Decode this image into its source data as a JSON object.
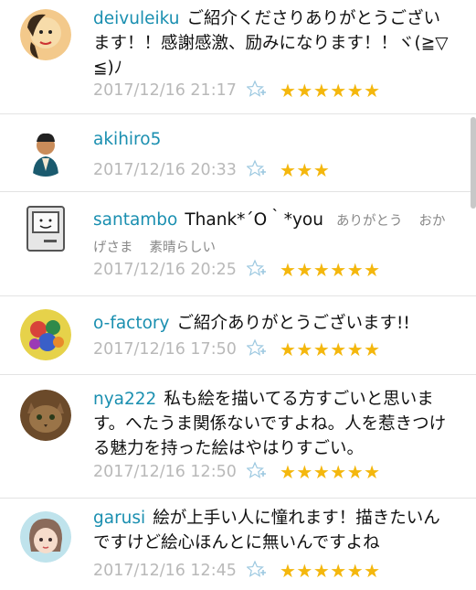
{
  "comments": [
    {
      "user": "deivuleiku",
      "text": "ご紹介くださりありがとうございます！！感謝感激、励みになります！！ヾ(≧▽≦)ﾉ",
      "tags": [],
      "timestamp": "2017/12/16 21:17",
      "stars": "★★★★★★",
      "star_count": 6
    },
    {
      "user": "akihiro5",
      "text": "",
      "tags": [],
      "timestamp": "2017/12/16 20:33",
      "stars": "★★★",
      "star_count": 3
    },
    {
      "user": "santambo",
      "text": "Thank*´O｀*you",
      "tags": [
        "ありがとう",
        "おかげさま",
        "素晴らしい"
      ],
      "timestamp": "2017/12/16 20:25",
      "stars": "★★★★★★",
      "star_count": 6
    },
    {
      "user": "o-factory",
      "text": "ご紹介ありがとうございます!!",
      "tags": [],
      "timestamp": "2017/12/16 17:50",
      "stars": "★★★★★★",
      "star_count": 6
    },
    {
      "user": "nya222",
      "text": "私も絵を描いてる方すごいと思います。へたうま関係ないですよね。人を惹きつける魅力を持った絵はやはりすごい。",
      "tags": [],
      "timestamp": "2017/12/16 12:50",
      "stars": "★★★★★★",
      "star_count": 6
    },
    {
      "user": "garusi",
      "text": "絵が上手い人に憧れます！描きたいんですけど絵心ほんとに無いんですよね",
      "tags": [],
      "timestamp": "2017/12/16 12:45",
      "stars": "★★★★★★",
      "star_count": 6
    }
  ],
  "icons": {
    "favorite": "star-plus-icon"
  },
  "colors": {
    "username": "#1a8fb0",
    "star": "#f4b70d",
    "timestamp": "#b9b9b9",
    "tag": "#888888"
  }
}
